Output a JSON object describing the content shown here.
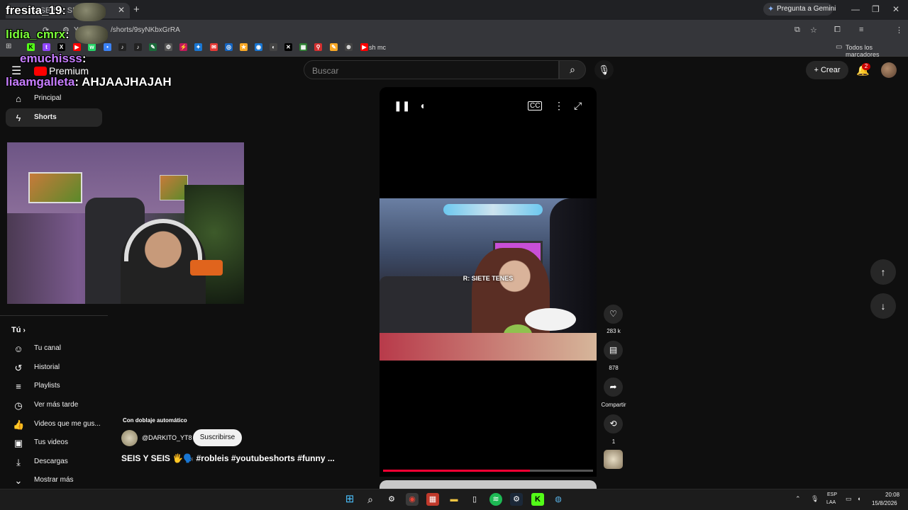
{
  "browser": {
    "tab_title": "(6) SEIS Y SEIS",
    "url": "/shorts/9syNKbxGrRA",
    "url_prefix": "Y",
    "gemini_label": "Pregunta a Gemini",
    "bookmark_last": "sh mc",
    "bookmarks_all": "Todos los marcadores"
  },
  "header": {
    "logo": "Premium",
    "search_placeholder": "Buscar",
    "create_label": "Crear",
    "notification_count": "2"
  },
  "sidebar": {
    "items": [
      {
        "label": "Principal",
        "icon": "home-icon"
      },
      {
        "label": "Shorts",
        "icon": "shorts-icon"
      }
    ],
    "you_header": "Tú",
    "you_items": [
      {
        "label": "Tu canal",
        "icon": "channel-icon"
      },
      {
        "label": "Historial",
        "icon": "history-icon"
      },
      {
        "label": "Playlists",
        "icon": "playlists-icon"
      },
      {
        "label": "Ver más tarde",
        "icon": "watch-later-icon"
      },
      {
        "label": "Videos que me gus...",
        "icon": "liked-icon"
      },
      {
        "label": "Tus videos",
        "icon": "your-videos-icon"
      },
      {
        "label": "Descargas",
        "icon": "downloads-icon"
      },
      {
        "label": "Mostrar más",
        "icon": "chevron-down-icon"
      }
    ]
  },
  "short": {
    "dub_label": "Con doblaje automático",
    "channel": "@DARKITO_YT8",
    "subscribe": "Suscribirse",
    "title": "SEIS Y SEIS 🖐️🗣️ #robleis #youtubeshorts #funny ...",
    "caption": "R: SIETE TENES",
    "progress": 0.7
  },
  "actions": {
    "likes": "283 k",
    "comments": "878",
    "share": "Compartir",
    "remix": "1"
  },
  "chat": [
    {
      "user": "fresita_19",
      "message": ":",
      "color": "#ffffff"
    },
    {
      "user": "lidia_cmrx",
      "message": ":",
      "color": "#7cff3a"
    },
    {
      "user": "emuchisss",
      "message": ":",
      "color": "#c77dff"
    },
    {
      "user": "liaamgalleta",
      "message": ": AHJAAJHAJAH",
      "color": "#c77dff"
    }
  ],
  "taskbar": {
    "lang1": "ESP",
    "lang2": "LAA",
    "time": "20:08",
    "date": "15/8/2026"
  },
  "colors": {
    "accent": "#ff0033",
    "background": "#0f0f0f"
  }
}
